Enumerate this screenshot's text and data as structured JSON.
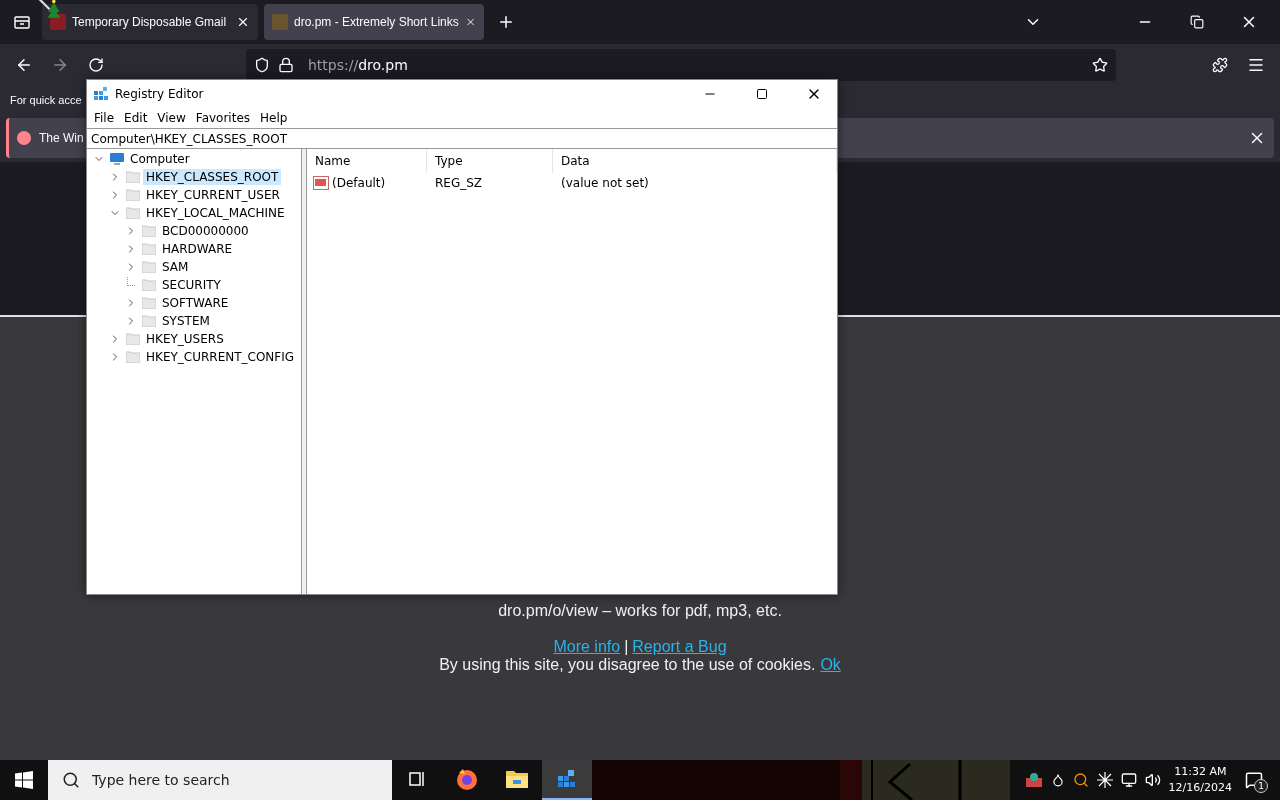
{
  "browser": {
    "tabs": [
      {
        "title": "Temporary Disposable Gmail",
        "selected": false
      },
      {
        "title": "dro.pm - Extremely Short Links",
        "selected": true
      }
    ],
    "url": {
      "scheme": "https://",
      "host": "dro.pm"
    },
    "bookmarks_hint": "For quick acce",
    "notification": "The Win"
  },
  "registry_editor": {
    "title": "Registry Editor",
    "menu": [
      "File",
      "Edit",
      "View",
      "Favorites",
      "Help"
    ],
    "address": "Computer\\HKEY_CLASSES_ROOT",
    "tree": [
      {
        "label": "Computer",
        "expanded": true,
        "selected": false,
        "children": [
          {
            "label": "HKEY_CLASSES_ROOT",
            "expanded": false,
            "selected": true
          },
          {
            "label": "HKEY_CURRENT_USER",
            "expanded": false,
            "selected": false
          },
          {
            "label": "HKEY_LOCAL_MACHINE",
            "expanded": true,
            "selected": false,
            "children": [
              {
                "label": "BCD00000000",
                "expanded": false,
                "selected": false
              },
              {
                "label": "HARDWARE",
                "expanded": false,
                "selected": false
              },
              {
                "label": "SAM",
                "expanded": false,
                "selected": false
              },
              {
                "label": "SECURITY",
                "selected": false
              },
              {
                "label": "SOFTWARE",
                "expanded": false,
                "selected": false
              },
              {
                "label": "SYSTEM",
                "expanded": false,
                "selected": false
              }
            ]
          },
          {
            "label": "HKEY_USERS",
            "expanded": false,
            "selected": false
          },
          {
            "label": "HKEY_CURRENT_CONFIG",
            "expanded": false,
            "selected": false
          }
        ]
      }
    ],
    "columns": [
      "Name",
      "Type",
      "Data"
    ],
    "rows": [
      {
        "name": "(Default)",
        "type": "REG_SZ",
        "data": "(value not set)"
      }
    ]
  },
  "page": {
    "tip": "dro.pm/o/view – works for pdf, mp3, etc.",
    "links": [
      "More info",
      "Report a Bug"
    ],
    "separator": "|",
    "cookie_text": "By using this site, you disagree to the use of cookies.",
    "cookie_ok": "Ok"
  },
  "taskbar": {
    "search_placeholder": "Type here to search",
    "apps": [
      {
        "kind": "taskview",
        "selected": false
      },
      {
        "kind": "browser",
        "selected": false
      },
      {
        "kind": "folder",
        "selected": false
      },
      {
        "kind": "registry",
        "selected": true
      }
    ],
    "time": "11:32 AM",
    "date": "12/16/2024",
    "notifications": "1"
  }
}
